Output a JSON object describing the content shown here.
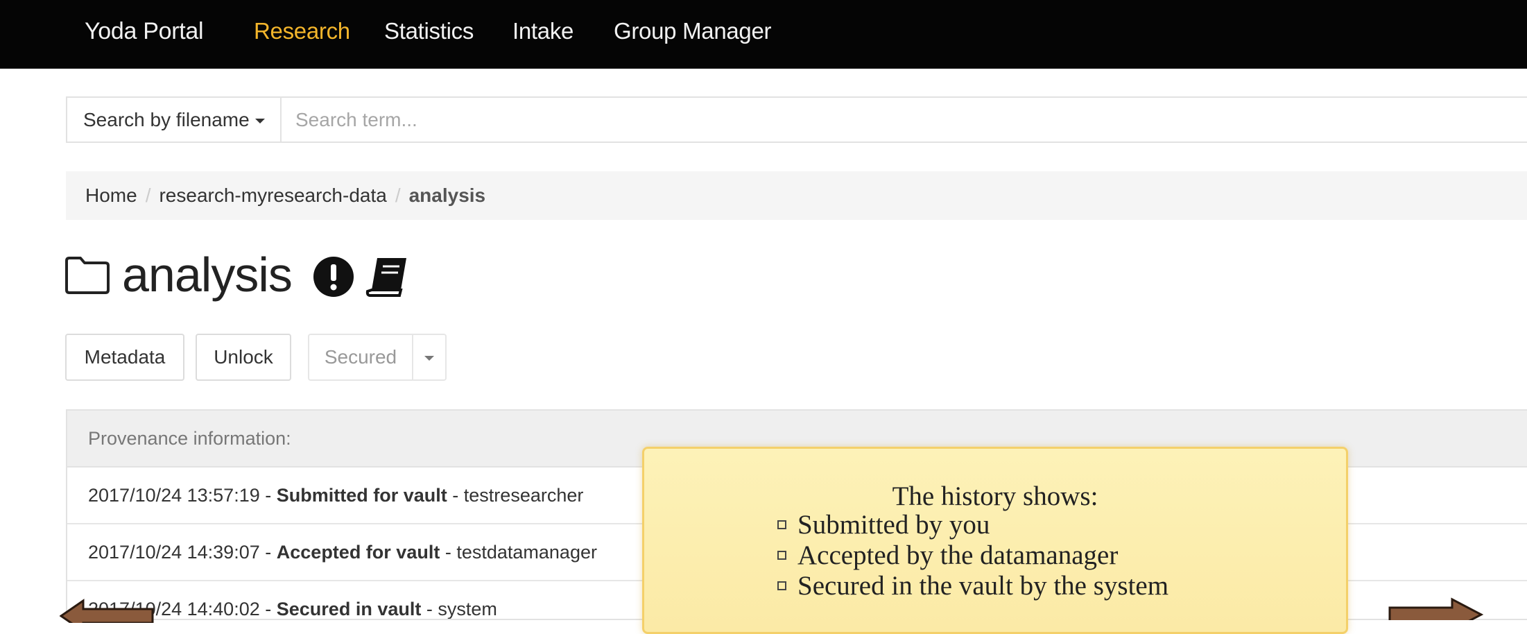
{
  "navbar": {
    "brand": "Yoda Portal",
    "items": [
      {
        "label": "Research",
        "active": true
      },
      {
        "label": "Statistics",
        "active": false
      },
      {
        "label": "Intake",
        "active": false
      },
      {
        "label": "Group Manager",
        "active": false
      }
    ],
    "colors": {
      "background": "#050505",
      "active": "#f3b52b",
      "text": "#f2f2f2"
    }
  },
  "search": {
    "dropdown_label": "Search by filename",
    "placeholder": "Search term...",
    "value": ""
  },
  "breadcrumb": {
    "items": [
      "Home",
      "research-myresearch-data",
      "analysis"
    ],
    "separator": "/"
  },
  "folder": {
    "title": "analysis",
    "icons": [
      "folder-icon",
      "exclamation-circle-icon",
      "book-icon"
    ]
  },
  "actions": {
    "metadata": "Metadata",
    "unlock": "Unlock",
    "status": "Secured"
  },
  "provenance": {
    "heading": "Provenance information:",
    "entries": [
      {
        "timestamp": "2017/10/24 13:57:19",
        "dash": "-",
        "action": "Submitted for vault",
        "user": "- testresearcher"
      },
      {
        "timestamp": "2017/10/24 14:39:07",
        "dash": "-",
        "action": "Accepted for vault",
        "user": "- testdatamanager"
      },
      {
        "timestamp": "2017/10/24 14:40:02",
        "dash": "-",
        "action": "Secured in vault",
        "user": "- system"
      }
    ]
  },
  "callout": {
    "title": "The history shows:",
    "items": [
      "Submitted by you",
      "Accepted by the datamanager",
      "Secured in the vault by the system"
    ],
    "colors": {
      "background": "#fcefb0",
      "border": "#f4d06a"
    }
  },
  "navigation_arrows": [
    "arrow-left-icon",
    "arrow-right-icon"
  ]
}
